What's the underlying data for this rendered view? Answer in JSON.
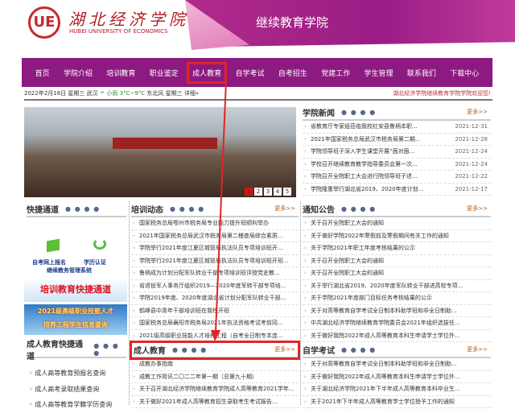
{
  "header": {
    "logo_cn": "湖北经济学院",
    "logo_en": "HUBEI UNIVERSITY OF ECONOMICS",
    "college": "继续教育学院",
    "logo_glyph": "UE"
  },
  "nav": [
    "首页",
    "学院介绍",
    "培训教育",
    "职业鉴定",
    "成人教育",
    "自学考试",
    "自考招生",
    "党建工作",
    "学生管理",
    "联系我们",
    "下载中心"
  ],
  "info": {
    "date": "2022年2月16日 星期三",
    "city": "武汉",
    "weather": "小雨 3°C~9°C",
    "wind": "东北风 星期三",
    "detail": "详细»",
    "marquee": "湖北经济学院继续教育学院学院欢迎您!"
  },
  "slideshow": {
    "pages": [
      "1",
      "2",
      "3",
      "4",
      "5"
    ]
  },
  "news": {
    "title": "学院新闻",
    "more": "更多>>",
    "items": [
      {
        "t": "省教育厅专家组莅临我校红安县鲁柄本职...",
        "d": "2021-12-31"
      },
      {
        "t": "2021年国家税务总局武汉市税务局第二期...",
        "d": "2021-12-28"
      },
      {
        "t": "学院领导班子深入学生课堂开展“面对面...",
        "d": "2021-12-24"
      },
      {
        "t": "学校召开继续教育教学指导委员会第一次...",
        "d": "2021-12-24"
      },
      {
        "t": "学院召开全院职工大会进行院领导班子述...",
        "d": "2021-12-22"
      },
      {
        "t": "学院隆重举行湖北省2019、2020年度计划...",
        "d": "2021-12-17"
      }
    ]
  },
  "quick": {
    "title": "快捷通道",
    "link1": "自考网上报名",
    "link2": "学历认证",
    "link3": "继续教务管理系统",
    "banner1": "培训教育快捷通道",
    "banner2a": "2021级高级职业技能人才",
    "banner2b": "培养工程学生信息查询"
  },
  "training": {
    "title": "培训动态",
    "more": "更多>>",
    "items": [
      "国家税务总局鄂州市税务局专业能力提升班顺利举办",
      "2021年国家税务总局武汉市税务局第二稽查局综合素质...",
      "学院举行2021年度江夏区城管局执法队员专项培训班开...",
      "学院举行2021年度江夏区城管局执法队员专项培训班开班...",
      "鲁柄成为计划分配军队转业干部专项培训班评授党史教...",
      "省退役军人事务厅组织2019—2020年度军转干部专项培...",
      "学院2019年度、2020年度湖北省计划分配军队转业干部...",
      "鹤峰县中青年干部培训班在我校开班",
      "国家税务总局襄阳市税务局2021年执法资格考试考前冈...",
      "2021级高级职业技能人才培养工程（自考全日制专本连..."
    ]
  },
  "notice": {
    "title": "通知公告",
    "more": "更多>>",
    "items": [
      "关于召开全院职工大会的通知",
      "关于做好学院2022年寒假前及寒假期间有关工作的通知",
      "关于学院2021年职工年度考核结果的公示",
      "关于召开全院职工大会的通知",
      "关于召开全院职工大会的通知",
      "关于举行湖北省2019、2020年度军队转业干部进高校专项...",
      "关于学院2021年度部门目标任务考核结果的公示",
      "关于对高等教育自学考试全日制本科助学班和非全日制助...",
      "中共湖北经济学院继续教育学院委员会2021年组织选拔任...",
      "关于做好我院2022年成人高等教育本科生申请学士学位外..."
    ]
  },
  "adult_quick": {
    "title": "成人教育快捷通道",
    "links": [
      "成人高等教育预报名查询",
      "成人高考录取结果查询",
      "成人高等教育学籍学历查询"
    ]
  },
  "adult": {
    "title": "成人教育",
    "more": "更多>>",
    "items": [
      "成教办事指南",
      "成教工作简讯二〇二二年第一期（总第九十期）",
      "关于召开湖北经济学院继续教育学院成人高等教育2021学年...",
      "关于做好2021年成人高等教育招生录取考生考试报告..."
    ]
  },
  "selfstudy": {
    "title": "自学考试",
    "more": "更多>>",
    "items": [
      "关于对高等教育自学考试全日制本科助学班和非全日制助...",
      "关于做好我院2022年成人高等教育本科生申请学士学位外...",
      "关于湖北经济学院2021年下半年成人高等教育本科毕业生...",
      "关于2021年下半年成人高等教育学士学位授予工作的通知"
    ]
  },
  "dots": "● ● ● ●",
  "colors": {
    "nav": "#8c1a80",
    "highlight": "#e02525",
    "more": "#b35a17"
  }
}
